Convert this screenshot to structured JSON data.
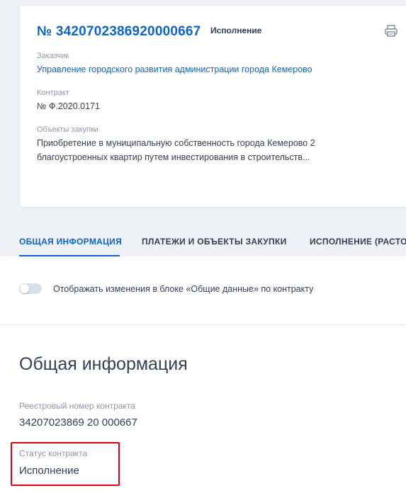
{
  "contract_card": {
    "number": "№ 3420702386920000667",
    "status": "Исполнение",
    "customer_label": "Заказчик",
    "customer_value": "Управление городского развития администрации города Кемерово",
    "contract_label": "Контракт",
    "contract_value": "№ Ф.2020.0171",
    "objects_label": "Объекты закупки",
    "objects_line1": "Приобретение в муниципальную собственность города Кемерово 2",
    "objects_line2": "благоустроенных квартир путем инвестирования в строительств...",
    "print_icon": "printer-icon"
  },
  "tabs": [
    {
      "label": "ОБЩАЯ ИНФОРМАЦИЯ"
    },
    {
      "label": "ПЛАТЕЖИ И ОБЪЕКТЫ ЗАКУПКИ"
    },
    {
      "label": "ИСПОЛНЕНИЕ (РАСТО"
    }
  ],
  "toggle": {
    "label": "Отображать изменения в блоке «Общие данные» по контракту",
    "checked": false
  },
  "general_info": {
    "title": "Общая информация",
    "reg_number_label": "Реестровый номер контракта",
    "reg_number_value": "34207023869 20 000667",
    "status_label": "Статус контракта",
    "status_value": "Исполнение"
  },
  "colors": {
    "accent": "#0d65c8",
    "highlight": "#e3000f",
    "background": "#eef1f5"
  }
}
